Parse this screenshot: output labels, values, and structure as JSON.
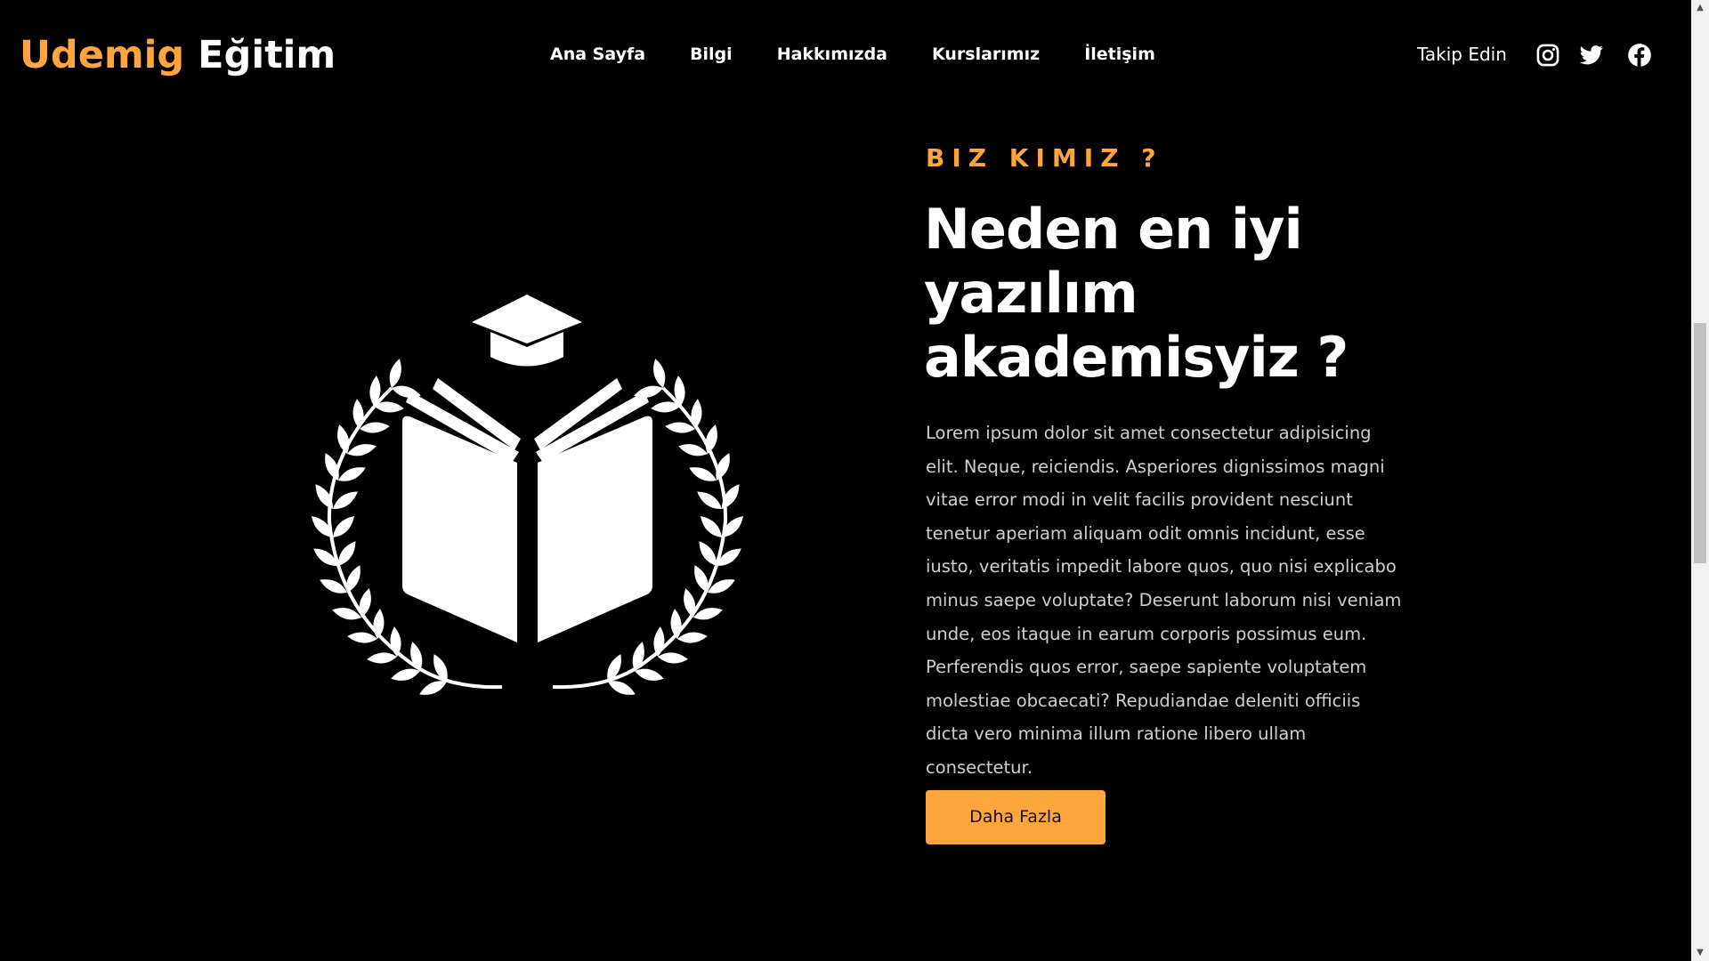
{
  "header": {
    "logo_accent": "Udemig",
    "logo_rest": "Eğitim",
    "nav": [
      {
        "label": "Ana Sayfa"
      },
      {
        "label": "Bilgi"
      },
      {
        "label": "Hakkımızda"
      },
      {
        "label": "Kurslarımız"
      },
      {
        "label": "İletişim"
      }
    ],
    "follow_label": "Takip Edin",
    "social_icons": [
      "instagram-icon",
      "twitter-icon",
      "facebook-icon"
    ]
  },
  "hero": {
    "graphic_icon": "graduation-laurel-book-icon",
    "eyebrow": "BIZ KIMIZ ?",
    "headline": "Neden en iyi yazılım akademisyiz ?",
    "body": "Lorem ipsum dolor sit amet consectetur adipisicing elit. Neque, reiciendis. Asperiores dignissimos magni vitae error modi in velit facilis provident nesciunt tenetur aperiam aliquam odit omnis incidunt, esse iusto, veritatis impedit labore quos, quo nisi explicabo minus saepe voluptate? Deserunt laborum nisi veniam unde, eos itaque in earum corporis possimus eum. Perferendis quos error, saepe sapiente voluptatem molestiae obcaecati? Repudiandae deleniti officiis dicta vero minima illum ratione libero ullam consectetur.",
    "cta_label": "Daha Fazla"
  },
  "colors": {
    "accent": "#ffa53c",
    "background": "#000000",
    "text": "#ffffff",
    "body_text": "#cfcfcf"
  },
  "scrollbar": {
    "position_fraction": 0.34
  }
}
